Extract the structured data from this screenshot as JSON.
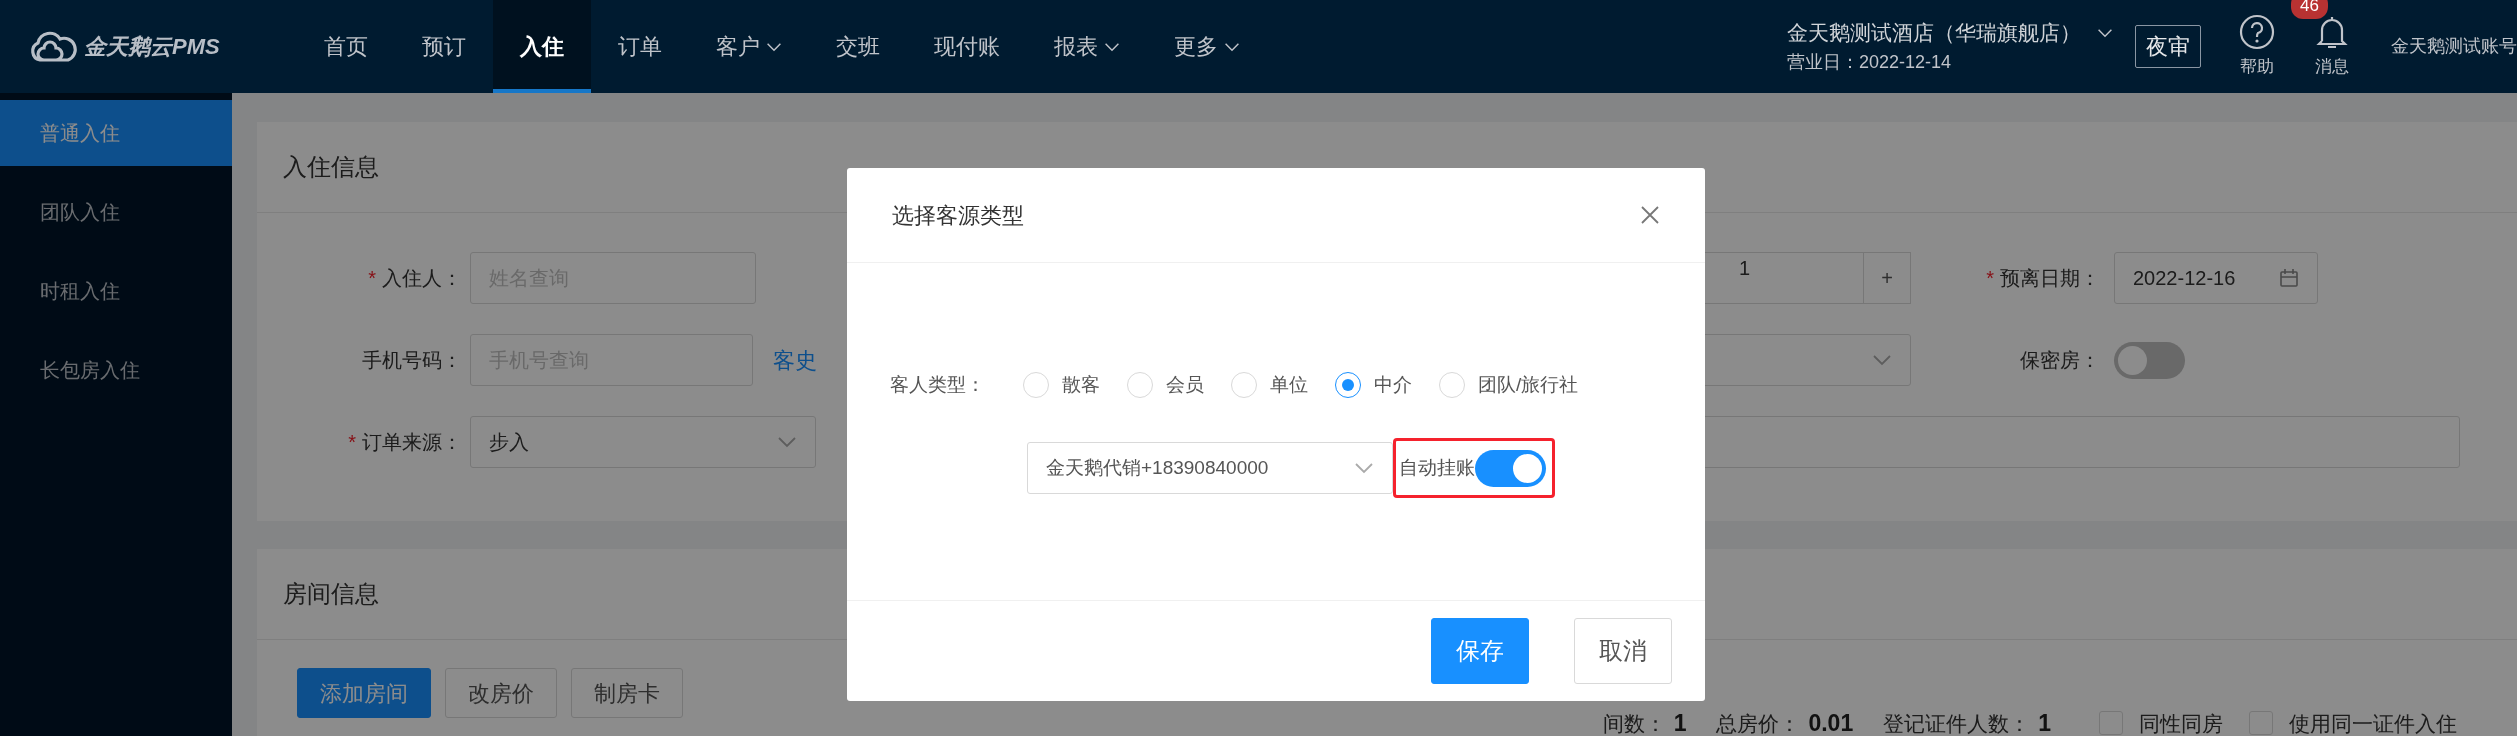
{
  "top_nav": {
    "logo": "金天鹅云PMS",
    "items": [
      {
        "label": "首页",
        "selected": false,
        "dropdown": false
      },
      {
        "label": "预订",
        "selected": false,
        "dropdown": false
      },
      {
        "label": "入住",
        "selected": true,
        "dropdown": false
      },
      {
        "label": "订单",
        "selected": false,
        "dropdown": false
      },
      {
        "label": "客户",
        "selected": false,
        "dropdown": true
      },
      {
        "label": "交班",
        "selected": false,
        "dropdown": false
      },
      {
        "label": "现付账",
        "selected": false,
        "dropdown": false
      },
      {
        "label": "报表",
        "selected": false,
        "dropdown": true
      },
      {
        "label": "更多",
        "selected": false,
        "dropdown": true
      }
    ],
    "hotel": {
      "name": "金天鹅测试酒店（华瑞旗舰店）",
      "business_date": "营业日：2022-12-14"
    },
    "night_audit": "夜审",
    "help": "帮助",
    "messages": {
      "label": "消息",
      "count": "46"
    },
    "account": "金天鹅测试账号"
  },
  "sidebar": {
    "items": [
      {
        "label": "普通入住",
        "selected": true
      },
      {
        "label": "团队入住",
        "selected": false
      },
      {
        "label": "时租入住",
        "selected": false
      },
      {
        "label": "长包房入住",
        "selected": false
      }
    ]
  },
  "checkin_info": {
    "title": "入住信息",
    "guest": {
      "required_mark": "*",
      "label": "入住人：",
      "placeholder": "姓名查询"
    },
    "phone": {
      "label": "手机号码：",
      "placeholder": "手机号查询",
      "history_link": "客史"
    },
    "order_source": {
      "required_mark": "*",
      "label": "订单来源：",
      "value": "步入"
    },
    "room_count": {
      "value": "1",
      "increment": "+"
    },
    "departure": {
      "required_mark": "*",
      "label": "预离日期：",
      "value": "2022-12-16"
    },
    "private_room": {
      "label": "保密房：",
      "on": false
    }
  },
  "room_info": {
    "title": "房间信息",
    "buttons": [
      {
        "label": "添加房间",
        "primary": true
      },
      {
        "label": "改房价",
        "primary": false
      },
      {
        "label": "制房卡",
        "primary": false
      }
    ],
    "summary": [
      {
        "label": "间数：",
        "value": "1"
      },
      {
        "label": "总房价：",
        "value": "0.01"
      },
      {
        "label": "登记证件人数：",
        "value": "1"
      }
    ],
    "options": [
      {
        "label": "同性同房",
        "checked": false
      },
      {
        "label": "使用同一证件入住",
        "checked": false
      }
    ]
  },
  "dialog": {
    "title": "选择客源类型",
    "guest_type_label": "客人类型：",
    "options": [
      {
        "label": "散客",
        "selected": false
      },
      {
        "label": "会员",
        "selected": false
      },
      {
        "label": "单位",
        "selected": false
      },
      {
        "label": "中介",
        "selected": true
      },
      {
        "label": "团队/旅行社",
        "selected": false
      }
    ],
    "agent_select": {
      "value": "金天鹅代销+18390840000"
    },
    "auto_charge": {
      "label": "自动挂账",
      "on": true
    },
    "buttons": [
      {
        "label": "保存",
        "primary": true
      },
      {
        "label": "取消",
        "primary": false
      }
    ]
  }
}
